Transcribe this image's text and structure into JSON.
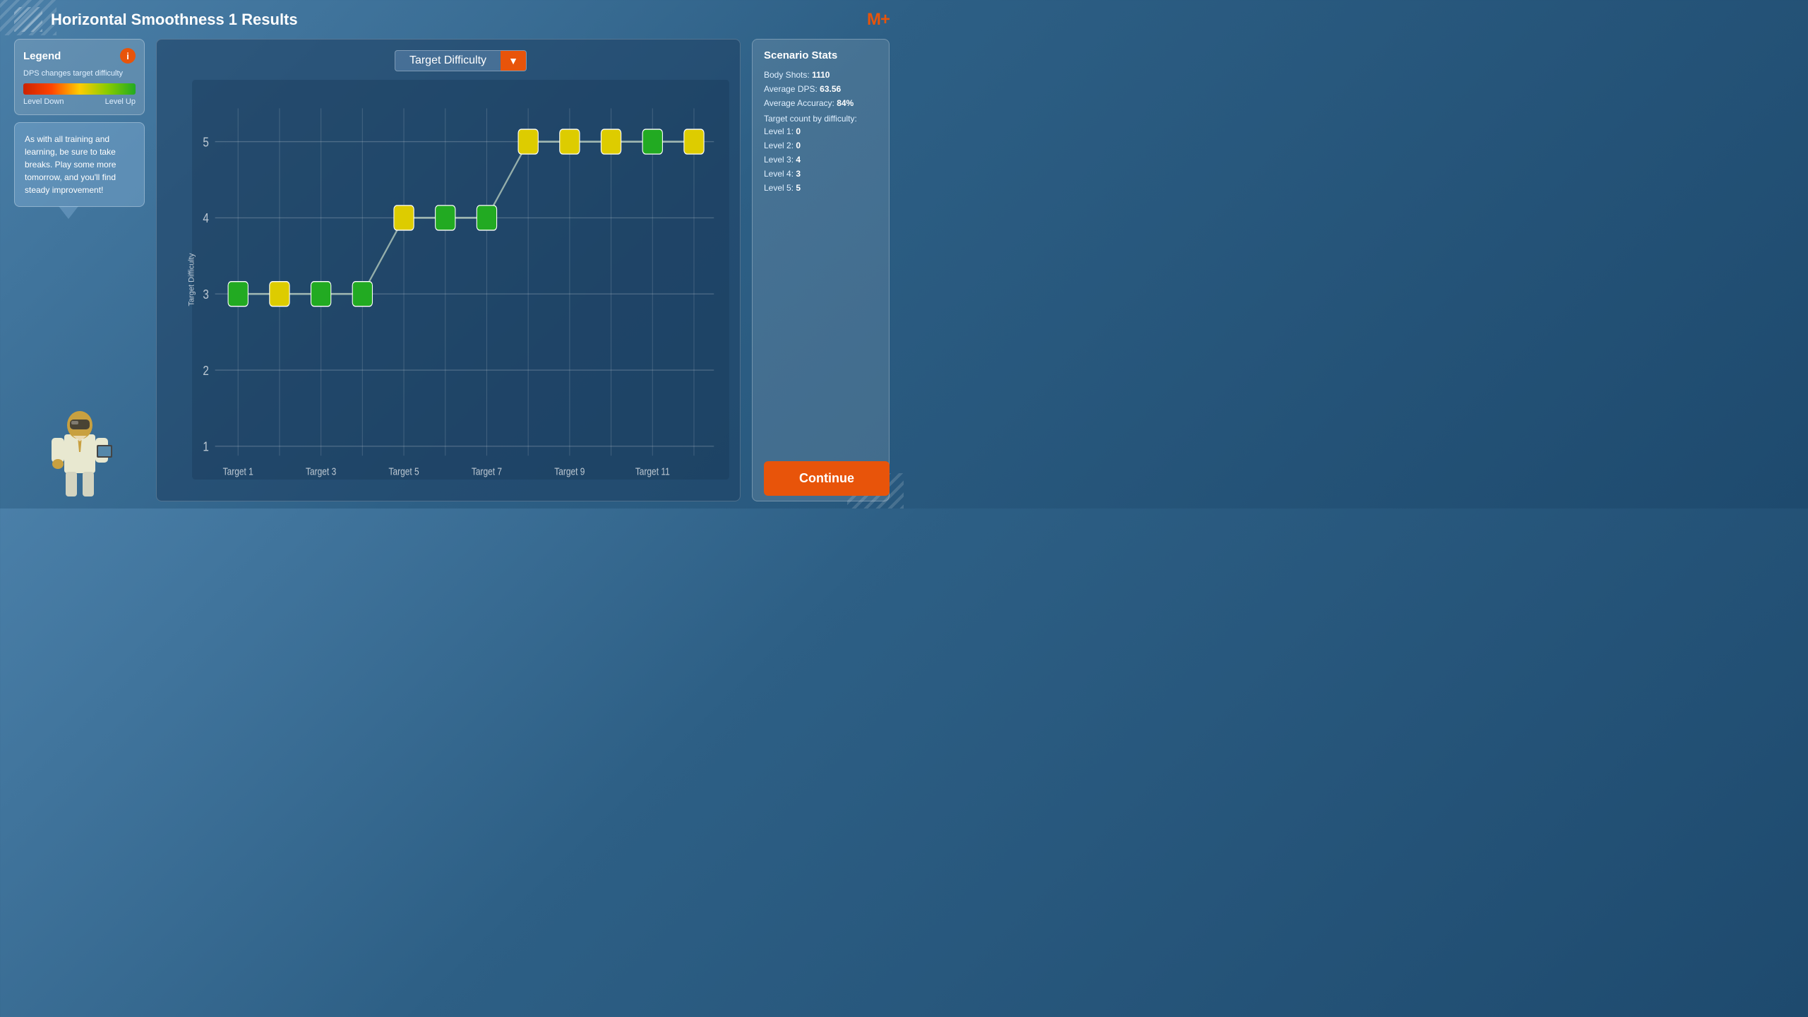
{
  "header": {
    "title": "Horizontal Smoothness 1 Results",
    "logo": "M+"
  },
  "legend": {
    "title": "Legend",
    "info_icon": "i",
    "description": "DPS changes target difficulty",
    "label_down": "Level Down",
    "label_up": "Level Up"
  },
  "tip": {
    "text": "As with all training and learning, be sure to take breaks. Play some more tomorrow, and you'll find steady improvement!"
  },
  "chart": {
    "dropdown_label": "Target Difficulty",
    "y_axis_label": "Target Difficulty",
    "x_labels": [
      "Target 1",
      "Target 3",
      "Target 5",
      "Target 7",
      "Target 9",
      "Target 11"
    ],
    "y_ticks": [
      1,
      2,
      3,
      4,
      5
    ],
    "points": [
      {
        "x": 1,
        "y": 3,
        "color": "green"
      },
      {
        "x": 2,
        "y": 3,
        "color": "yellow"
      },
      {
        "x": 3,
        "y": 3,
        "color": "green"
      },
      {
        "x": 4,
        "y": 3,
        "color": "green"
      },
      {
        "x": 5,
        "y": 4,
        "color": "yellow"
      },
      {
        "x": 6,
        "y": 4,
        "color": "green"
      },
      {
        "x": 7,
        "y": 4,
        "color": "green"
      },
      {
        "x": 8,
        "y": 5,
        "color": "yellow"
      },
      {
        "x": 9,
        "y": 5,
        "color": "yellow"
      },
      {
        "x": 10,
        "y": 5,
        "color": "yellow"
      },
      {
        "x": 11,
        "y": 5,
        "color": "green"
      },
      {
        "x": 12,
        "y": 5,
        "color": "yellow"
      }
    ]
  },
  "stats": {
    "title": "Scenario Stats",
    "body_shots_label": "Body Shots:",
    "body_shots_value": "1110",
    "avg_dps_label": "Average DPS:",
    "avg_dps_value": "63.56",
    "avg_accuracy_label": "Average Accuracy:",
    "avg_accuracy_value": "84%",
    "target_count_label": "Target count by difficulty:",
    "levels": [
      {
        "label": "Level 1:",
        "value": "0"
      },
      {
        "label": "Level 2:",
        "value": "0"
      },
      {
        "label": "Level 3:",
        "value": "4"
      },
      {
        "label": "Level 4:",
        "value": "3"
      },
      {
        "label": "Level 5:",
        "value": "5"
      }
    ]
  },
  "buttons": {
    "continue_label": "Continue"
  }
}
